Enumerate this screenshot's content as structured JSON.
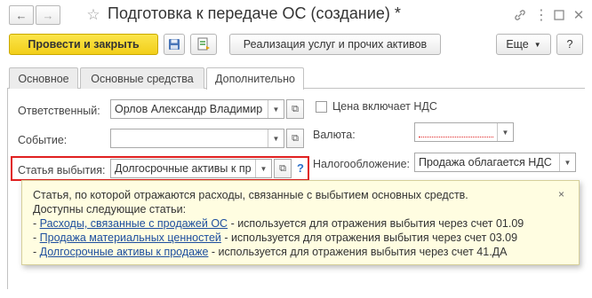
{
  "window": {
    "title": "Подготовка к передаче ОС (создание) *",
    "back_icon": "arrow-left-icon",
    "forward_icon": "arrow-right-icon",
    "star_icon": "star-icon",
    "link_icon": "link-icon",
    "more_icon": "dots-icon",
    "maximize_icon": "maximize-icon",
    "close_icon": "close-icon"
  },
  "toolbar": {
    "post_close_label": "Провести и закрыть",
    "save_icon": "floppy-disk-icon",
    "document_icon": "document-icon",
    "realization_label": "Реализация услуг и прочих активов",
    "more_label": "Еще",
    "help_label": "?"
  },
  "tabs": [
    {
      "label": "Основное",
      "active": false
    },
    {
      "label": "Основные средства",
      "active": false
    },
    {
      "label": "Дополнительно",
      "active": true
    }
  ],
  "form": {
    "responsible_label": "Ответственный:",
    "responsible_value": "Орлов Александр Владимир",
    "event_label": "Событие:",
    "event_value": "",
    "disposal_label": "Статья выбытия:",
    "disposal_value": "Долгосрочные активы к пр",
    "help_mark": "?",
    "price_vat_label": "Цена включает НДС",
    "price_vat_checked": false,
    "currency_label": "Валюта:",
    "currency_value": "",
    "taxation_label": "Налогообложение:",
    "taxation_value": "Продажа облагается НДС"
  },
  "tooltip": {
    "line1": "Статья, по которой отражаются расходы, связанные с выбытием основных средств.",
    "line2": "Доступны следующие статьи:",
    "items": [
      {
        "prefix": "- ",
        "link": "Расходы, связанные с продажей ОС",
        "text": " - используется для отражения выбытия через счет 01.09"
      },
      {
        "prefix": "- ",
        "link": "Продажа материальных ценностей",
        "text": " - используется для отражения выбытия через счет 03.09"
      },
      {
        "prefix": "- ",
        "link": "Долгосрочные активы к продаже",
        "text": " - используется для отражения выбытия через счет 41.ДА"
      }
    ],
    "close_label": "×"
  },
  "colors": {
    "accent_yellow": "#f5d327",
    "highlight_red": "#e02020",
    "link_blue": "#1d4e9e",
    "tooltip_bg": "#fffde1"
  }
}
